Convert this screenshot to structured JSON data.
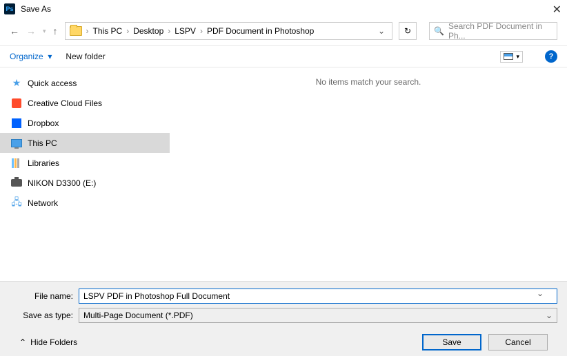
{
  "title": "Save As",
  "breadcrumbs": [
    "This PC",
    "Desktop",
    "LSPV",
    "PDF Document in Photoshop"
  ],
  "search_placeholder": "Search PDF Document in Ph...",
  "toolbar": {
    "organize": "Organize",
    "new_folder": "New folder"
  },
  "sidebar": {
    "items": [
      {
        "label": "Quick access"
      },
      {
        "label": "Creative Cloud Files"
      },
      {
        "label": "Dropbox"
      },
      {
        "label": "This PC"
      },
      {
        "label": "Libraries"
      },
      {
        "label": "NIKON D3300 (E:)"
      },
      {
        "label": "Network"
      }
    ]
  },
  "empty_message": "No items match your search.",
  "filename_label": "File name:",
  "filename_value": "LSPV PDF in Photoshop Full Document",
  "saveas_label": "Save as type:",
  "saveas_value": "Multi-Page Document (*.PDF)",
  "hide_folders": "Hide Folders",
  "buttons": {
    "save": "Save",
    "cancel": "Cancel"
  }
}
